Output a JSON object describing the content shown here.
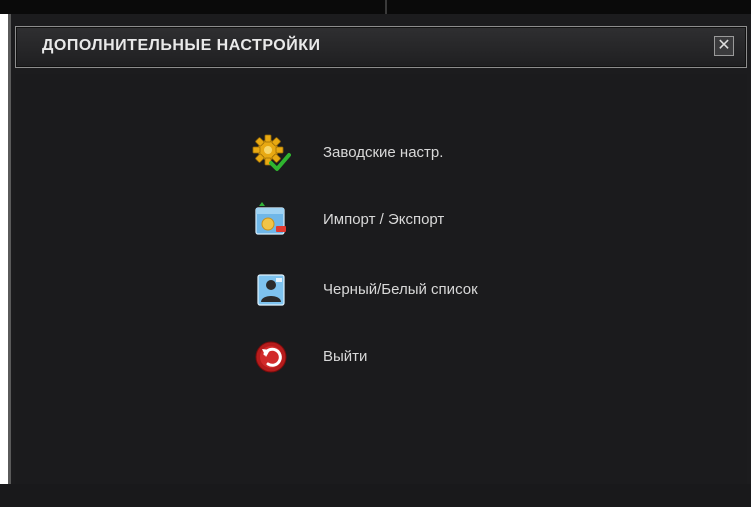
{
  "window": {
    "title": "ДОПОЛНИТЕЛЬНЫЕ НАСТРОЙКИ",
    "close_symbol": "✕"
  },
  "menu": {
    "items": [
      {
        "label": "Заводские настр.",
        "icon": "gear-check-icon"
      },
      {
        "label": "Импорт / Экспорт",
        "icon": "import-export-icon"
      },
      {
        "label": "Черный/Белый список",
        "icon": "user-list-icon"
      },
      {
        "label": "Выйти",
        "icon": "exit-icon"
      }
    ]
  },
  "colors": {
    "background": "#1c1c1e",
    "title_text": "#e9e9e9",
    "label_text": "#d8d8d8",
    "border": "#8d8d8d"
  }
}
